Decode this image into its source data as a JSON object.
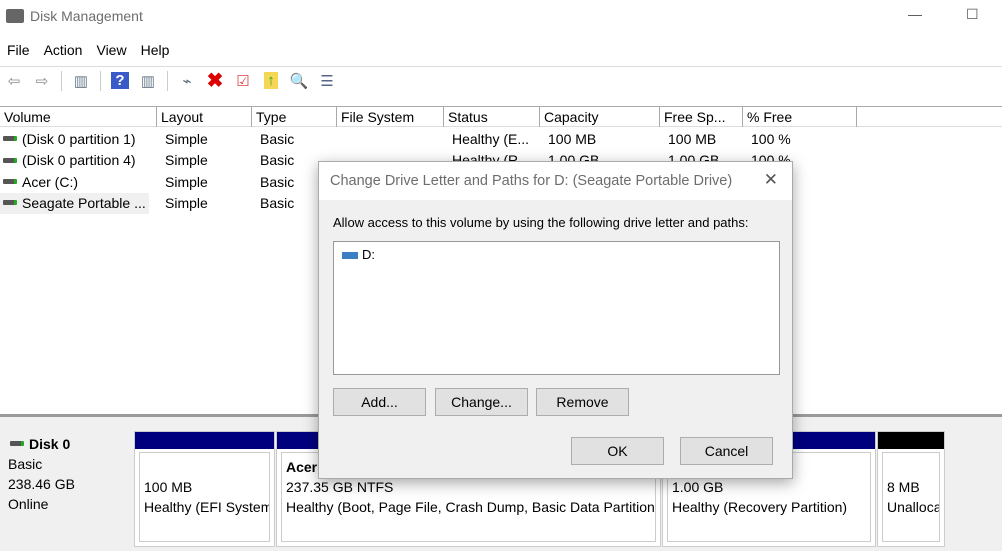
{
  "window": {
    "title": "Disk Management",
    "minimize": "—",
    "maximize": "☐"
  },
  "menu": [
    "File",
    "Action",
    "View",
    "Help"
  ],
  "toolbar": [
    "back-icon",
    "forward-icon",
    "console-tree-icon",
    "help-icon",
    "action-pane-icon",
    "connect-disk-icon",
    "delete-icon",
    "properties-icon",
    "up-icon",
    "search-icon",
    "settings-icon"
  ],
  "columns": [
    "Volume",
    "Layout",
    "Type",
    "File System",
    "Status",
    "Capacity",
    "Free Sp...",
    "% Free"
  ],
  "rows": [
    [
      "(Disk 0 partition 1)",
      "Simple",
      "Basic",
      "",
      "Healthy (E...",
      "100 MB",
      "100 MB",
      "100 %"
    ],
    [
      "(Disk 0 partition 4)",
      "Simple",
      "Basic",
      "",
      "Healthy (R...",
      "1.00 GB",
      "1.00 GB",
      "100 %"
    ],
    [
      "Acer (C:)",
      "Simple",
      "Basic",
      "",
      "",
      "",
      "",
      ""
    ],
    [
      "Seagate Portable ...",
      "Simple",
      "Basic",
      "",
      "",
      "",
      "",
      ""
    ]
  ],
  "disk": {
    "name": "Disk 0",
    "type": "Basic",
    "size": "238.46 GB",
    "status": "Online",
    "partitions": [
      {
        "label": "",
        "size": "100 MB",
        "status": "Healthy (EFI System Partition)",
        "color": "#00007f"
      },
      {
        "label": "Acer",
        "size": "237.35 GB NTFS",
        "status": "Healthy (Boot, Page File, Crash Dump, Basic Data Partition)",
        "color": "#00007f"
      },
      {
        "label": "",
        "size": "1.00 GB",
        "status": "Healthy (Recovery Partition)",
        "color": "#00007f"
      },
      {
        "label": "",
        "size": "8 MB",
        "status": "Unallocated",
        "color": "#000000"
      }
    ]
  },
  "dialog": {
    "title": "Change Drive Letter and Paths for D: (Seagate Portable Drive)",
    "close": "✕",
    "instruction": "Allow access to this volume by using the following drive letter and paths:",
    "paths": [
      "D:"
    ],
    "add": "Add...",
    "change": "Change...",
    "remove": "Remove",
    "ok": "OK",
    "cancel": "Cancel"
  }
}
